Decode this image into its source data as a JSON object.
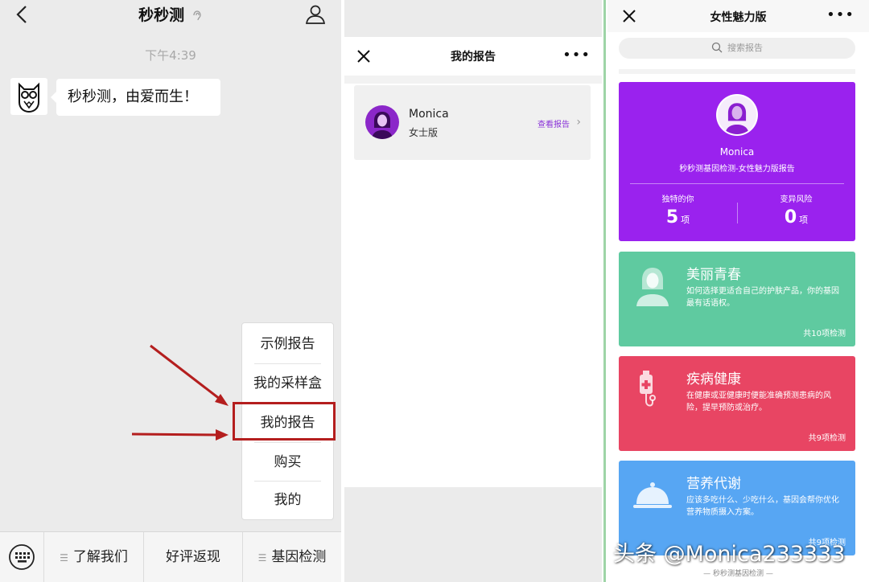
{
  "chat": {
    "title": "秒秒测",
    "timestamp": "下午4:39",
    "message": "秒秒测，由爱而生！",
    "menu_items": [
      "示例报告",
      "我的采样盒",
      "我的报告",
      "购买",
      "我的"
    ],
    "bottom_tabs": [
      "了解我们",
      "好评返现",
      "基因检测"
    ],
    "highlight_color": "#b41e1e"
  },
  "reports": {
    "title": "我的报告",
    "entry": {
      "name": "Monica",
      "edition": "女士版",
      "link": "查看报告"
    }
  },
  "detail": {
    "title": "女性魅力版",
    "search_placeholder": "搜索报告",
    "profile": {
      "name": "Monica",
      "report": "秒秒测基因检测-女性魅力版报告",
      "stats": [
        {
          "label": "独特的你",
          "value": "5",
          "unit": "项"
        },
        {
          "label": "变异风险",
          "value": "0",
          "unit": "项"
        }
      ],
      "color": "#9a22ee"
    },
    "categories": [
      {
        "title": "美丽青春",
        "desc": "如何选择更适合自己的护肤产品，你的基因最有话语权。",
        "count": "共10项检测",
        "color": "#5fcaa0",
        "icon": "woman-silhouette-icon"
      },
      {
        "title": "疾病健康",
        "desc": "在健康或亚健康时便能准确预测患病的风险，提早预防或治疗。",
        "count": "共9项检测",
        "color": "#e84563",
        "icon": "iv-bag-icon"
      },
      {
        "title": "营养代谢",
        "desc": "应该多吃什么、少吃什么，基因会帮你优化营养物质摄入方案。",
        "count": "共9项检测",
        "color": "#57a6f3",
        "icon": "food-cloche-icon"
      }
    ],
    "footer": "— 秒秒测基因检测 —"
  },
  "watermark": "头条 @Monica233333"
}
